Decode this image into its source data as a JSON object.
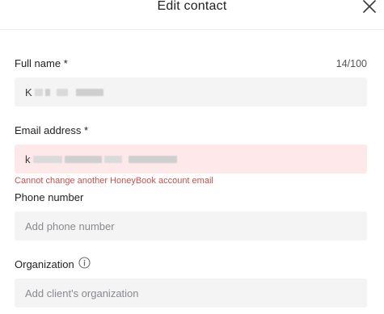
{
  "dialog": {
    "title": "Edit contact"
  },
  "fields": {
    "full_name": {
      "label": "Full name *",
      "counter": "14/100",
      "value_initial": "K"
    },
    "email": {
      "label": "Email address *",
      "value_initial": "k",
      "error": "Cannot change another HoneyBook account email"
    },
    "phone": {
      "label": "Phone number",
      "placeholder": "Add phone number"
    },
    "organization": {
      "label": "Organization",
      "placeholder": "Add client's organization"
    }
  },
  "icons": {
    "close": "close-icon",
    "info": "info-icon"
  },
  "colors": {
    "error_text": "#c8504f",
    "error_field_bg": "#fde9e9",
    "field_bg": "#f4f4f5"
  }
}
